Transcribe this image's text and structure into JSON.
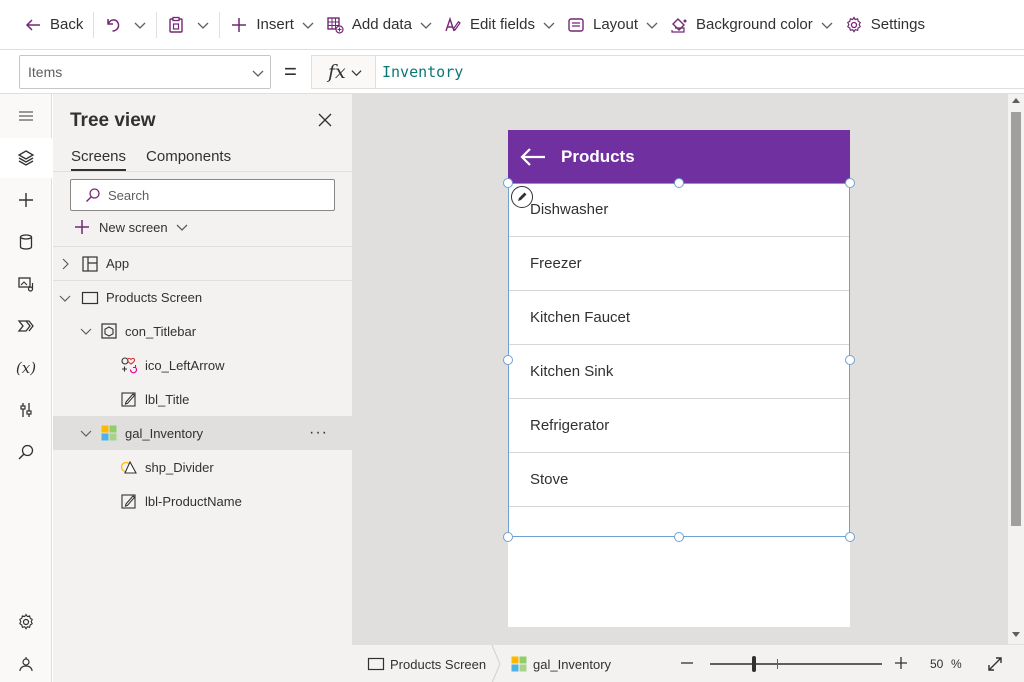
{
  "toolbar": {
    "back_label": "Back",
    "insert_label": "Insert",
    "add_data_label": "Add data",
    "edit_fields_label": "Edit fields",
    "layout_label": "Layout",
    "background_color_label": "Background color",
    "settings_label": "Settings"
  },
  "formula_bar": {
    "property": "Items",
    "equals": "=",
    "fx": "fx",
    "formula": "Inventory"
  },
  "tree_view": {
    "title": "Tree view",
    "tabs": [
      {
        "label": "Screens",
        "selected": true
      },
      {
        "label": "Components",
        "selected": false
      }
    ],
    "search_placeholder": "Search",
    "new_screen_label": "New screen",
    "nodes": [
      {
        "label": "App",
        "icon": "app-icon"
      },
      {
        "label": "Products Screen",
        "icon": "screen-icon"
      },
      {
        "label": "con_Titlebar",
        "icon": "container-icon"
      },
      {
        "label": "ico_LeftArrow",
        "icon": "icon-control-icon"
      },
      {
        "label": "lbl_Title",
        "icon": "label-icon"
      },
      {
        "label": "gal_Inventory",
        "icon": "gallery-icon",
        "selected": true
      },
      {
        "label": "shp_Divider",
        "icon": "shape-icon"
      },
      {
        "label": "lbl-ProductName",
        "icon": "label-icon"
      }
    ],
    "more_label": "···"
  },
  "app_screen": {
    "title": "Products",
    "accent": "#7030a0",
    "items": [
      "Dishwasher",
      "Freezer",
      "Kitchen Faucet",
      "Kitchen Sink",
      "Refrigerator",
      "Stove"
    ]
  },
  "status_bar": {
    "screen_crumb": "Products Screen",
    "control_crumb": "gal_Inventory",
    "zoom_value": "50",
    "zoom_unit": "%"
  },
  "colors": {
    "brand": "#742774",
    "selection": "#6fa1d4"
  }
}
